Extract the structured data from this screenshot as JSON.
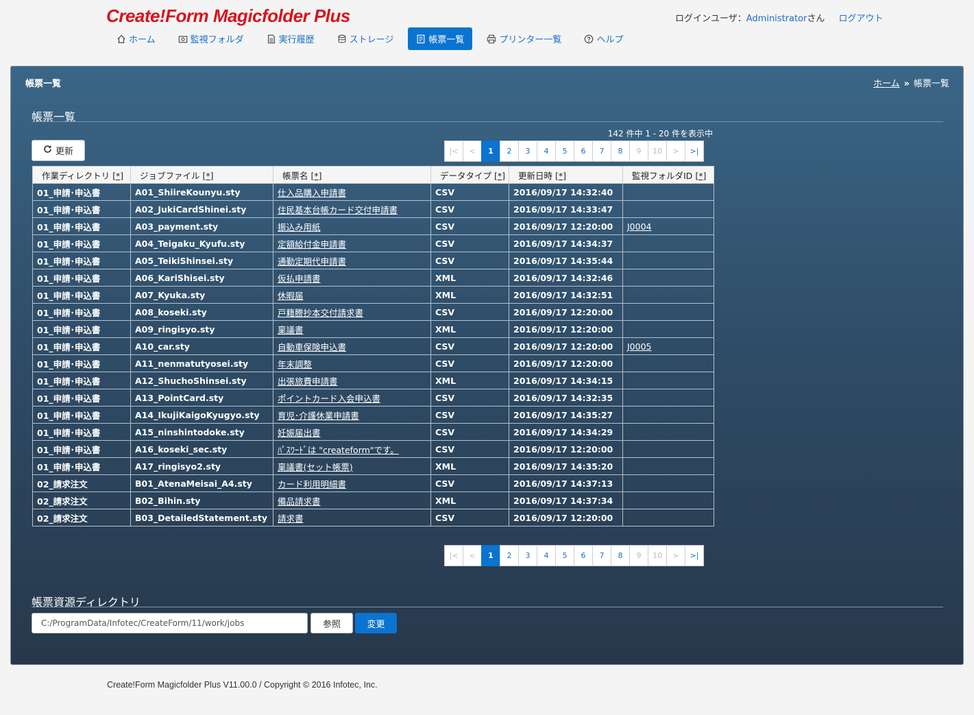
{
  "app": {
    "logo": "Create!Form Magicfolder Plus",
    "user_label": "ログインユーザ：",
    "user_name": "Administrator",
    "user_suffix": "さん",
    "logout": "ログアウト"
  },
  "nav": [
    {
      "id": "home",
      "label": "ホーム",
      "icon": "home-icon",
      "active": false
    },
    {
      "id": "watch",
      "label": "監視フォルダ",
      "icon": "folder-search-icon",
      "active": false
    },
    {
      "id": "history",
      "label": "実行履歴",
      "icon": "document-icon",
      "active": false
    },
    {
      "id": "storage",
      "label": "ストレージ",
      "icon": "database-icon",
      "active": false
    },
    {
      "id": "forms",
      "label": "帳票一覧",
      "icon": "form-list-icon",
      "active": true
    },
    {
      "id": "printers",
      "label": "プリンター一覧",
      "icon": "printer-icon",
      "active": false
    },
    {
      "id": "help",
      "label": "ヘルプ",
      "icon": "help-icon",
      "active": false
    }
  ],
  "panel": {
    "title": "帳票一覧",
    "breadcrumb_home": "ホーム",
    "breadcrumb_sep": "»",
    "breadcrumb_current": "帳票一覧"
  },
  "list": {
    "section_title": "帳票一覧",
    "count_text": "142 件中  1 - 20 件を表示中",
    "refresh_label": "更新",
    "columns": [
      {
        "label": "作業ディレクトリ",
        "sort": "[*]",
        "width": 143
      },
      {
        "label": "ジョブファイル",
        "sort": "[*]",
        "width": 208
      },
      {
        "label": "帳票名",
        "sort": "[*]",
        "width": 230
      },
      {
        "label": "データタイプ",
        "sort": "[*]",
        "width": 114
      },
      {
        "label": "更新日時",
        "sort": "[*]",
        "width": 166
      },
      {
        "label": "監視フォルダID",
        "sort": "[*]",
        "width": 133
      }
    ],
    "rows": [
      [
        "01_申請･申込書",
        "A01_ShiireKounyu.sty",
        "仕入品購入申請書",
        "CSV",
        "2016/09/17 14:32:40",
        ""
      ],
      [
        "01_申請･申込書",
        "A02_JukiCardShinei.sty",
        "住民基本台帳カード交付申請書",
        "CSV",
        "2016/09/17 14:33:47",
        ""
      ],
      [
        "01_申請･申込書",
        "A03_payment.sty",
        "振込み用紙",
        "CSV",
        "2016/09/17 12:20:00",
        "J0004"
      ],
      [
        "01_申請･申込書",
        "A04_Teigaku_Kyufu.sty",
        "定額給付金申請書",
        "CSV",
        "2016/09/17 14:34:37",
        ""
      ],
      [
        "01_申請･申込書",
        "A05_TeikiShinsei.sty",
        "通勤定期代申請書",
        "CSV",
        "2016/09/17 14:35:44",
        ""
      ],
      [
        "01_申請･申込書",
        "A06_KariShisei.sty",
        "仮払申請書",
        "XML",
        "2016/09/17 14:32:46",
        ""
      ],
      [
        "01_申請･申込書",
        "A07_Kyuka.sty",
        "休暇届",
        "XML",
        "2016/09/17 14:32:51",
        ""
      ],
      [
        "01_申請･申込書",
        "A08_koseki.sty",
        "戸籍謄抄本交付請求書",
        "CSV",
        "2016/09/17 12:20:00",
        ""
      ],
      [
        "01_申請･申込書",
        "A09_ringisyo.sty",
        "稟議書",
        "XML",
        "2016/09/17 12:20:00",
        ""
      ],
      [
        "01_申請･申込書",
        "A10_car.sty",
        "自動車保険申込書",
        "CSV",
        "2016/09/17 12:20:00",
        "J0005"
      ],
      [
        "01_申請･申込書",
        "A11_nenmatutyosei.sty",
        "年末調整",
        "CSV",
        "2016/09/17 12:20:00",
        ""
      ],
      [
        "01_申請･申込書",
        "A12_ShuchoShinsei.sty",
        "出張旅費申請書",
        "XML",
        "2016/09/17 14:34:15",
        ""
      ],
      [
        "01_申請･申込書",
        "A13_PointCard.sty",
        "ポイントカード入会申込書",
        "CSV",
        "2016/09/17 14:32:35",
        ""
      ],
      [
        "01_申請･申込書",
        "A14_IkujiKaigoKyugyo.sty",
        "育児･介護休業申請書",
        "CSV",
        "2016/09/17 14:35:27",
        ""
      ],
      [
        "01_申請･申込書",
        "A15_ninshintodoke.sty",
        "妊娠届出書",
        "CSV",
        "2016/09/17 14:34:29",
        ""
      ],
      [
        "01_申請･申込書",
        "A16_koseki_sec.sty",
        "ﾊﾟｽﾜｰﾄﾞは \"createform\"です。",
        "CSV",
        "2016/09/17 12:20:00",
        ""
      ],
      [
        "01_申請･申込書",
        "A17_ringisyo2.sty",
        "稟議書(セット帳票)",
        "XML",
        "2016/09/17 14:35:20",
        ""
      ],
      [
        "02_請求注文",
        "B01_AtenaMeisai_A4.sty",
        "カード利用明細書",
        "CSV",
        "2016/09/17 14:37:13",
        ""
      ],
      [
        "02_請求注文",
        "B02_Bihin.sty",
        "備品請求書",
        "XML",
        "2016/09/17 14:37:34",
        ""
      ],
      [
        "02_請求注文",
        "B03_DetailedStatement.sty",
        "請求書",
        "CSV",
        "2016/09/17 12:20:00",
        ""
      ]
    ],
    "pager": [
      {
        "label": "|<",
        "state": "disabled"
      },
      {
        "label": "<",
        "state": "disabled"
      },
      {
        "label": "1",
        "state": "current"
      },
      {
        "label": "2",
        "state": "normal"
      },
      {
        "label": "3",
        "state": "normal"
      },
      {
        "label": "4",
        "state": "normal"
      },
      {
        "label": "5",
        "state": "normal"
      },
      {
        "label": "6",
        "state": "normal"
      },
      {
        "label": "7",
        "state": "normal"
      },
      {
        "label": "8",
        "state": "normal"
      },
      {
        "label": "9",
        "state": "disabled"
      },
      {
        "label": "10",
        "state": "disabled"
      },
      {
        "label": ">",
        "state": "disabled"
      },
      {
        "label": ">|",
        "state": "normal"
      }
    ]
  },
  "resource": {
    "section_title": "帳票資源ディレクトリ",
    "path_value": "C:/ProgramData/Infotec/CreateForm/11/work/jobs",
    "browse_label": "参照",
    "change_label": "変更"
  },
  "footer": {
    "copyright": "Create!Form Magicfolder Plus V11.00.0 / Copyright © 2016 Infotec, Inc."
  },
  "colors": {
    "accent": "#0b73d0",
    "logo": "#d8141b",
    "link": "#1a6fc9"
  }
}
